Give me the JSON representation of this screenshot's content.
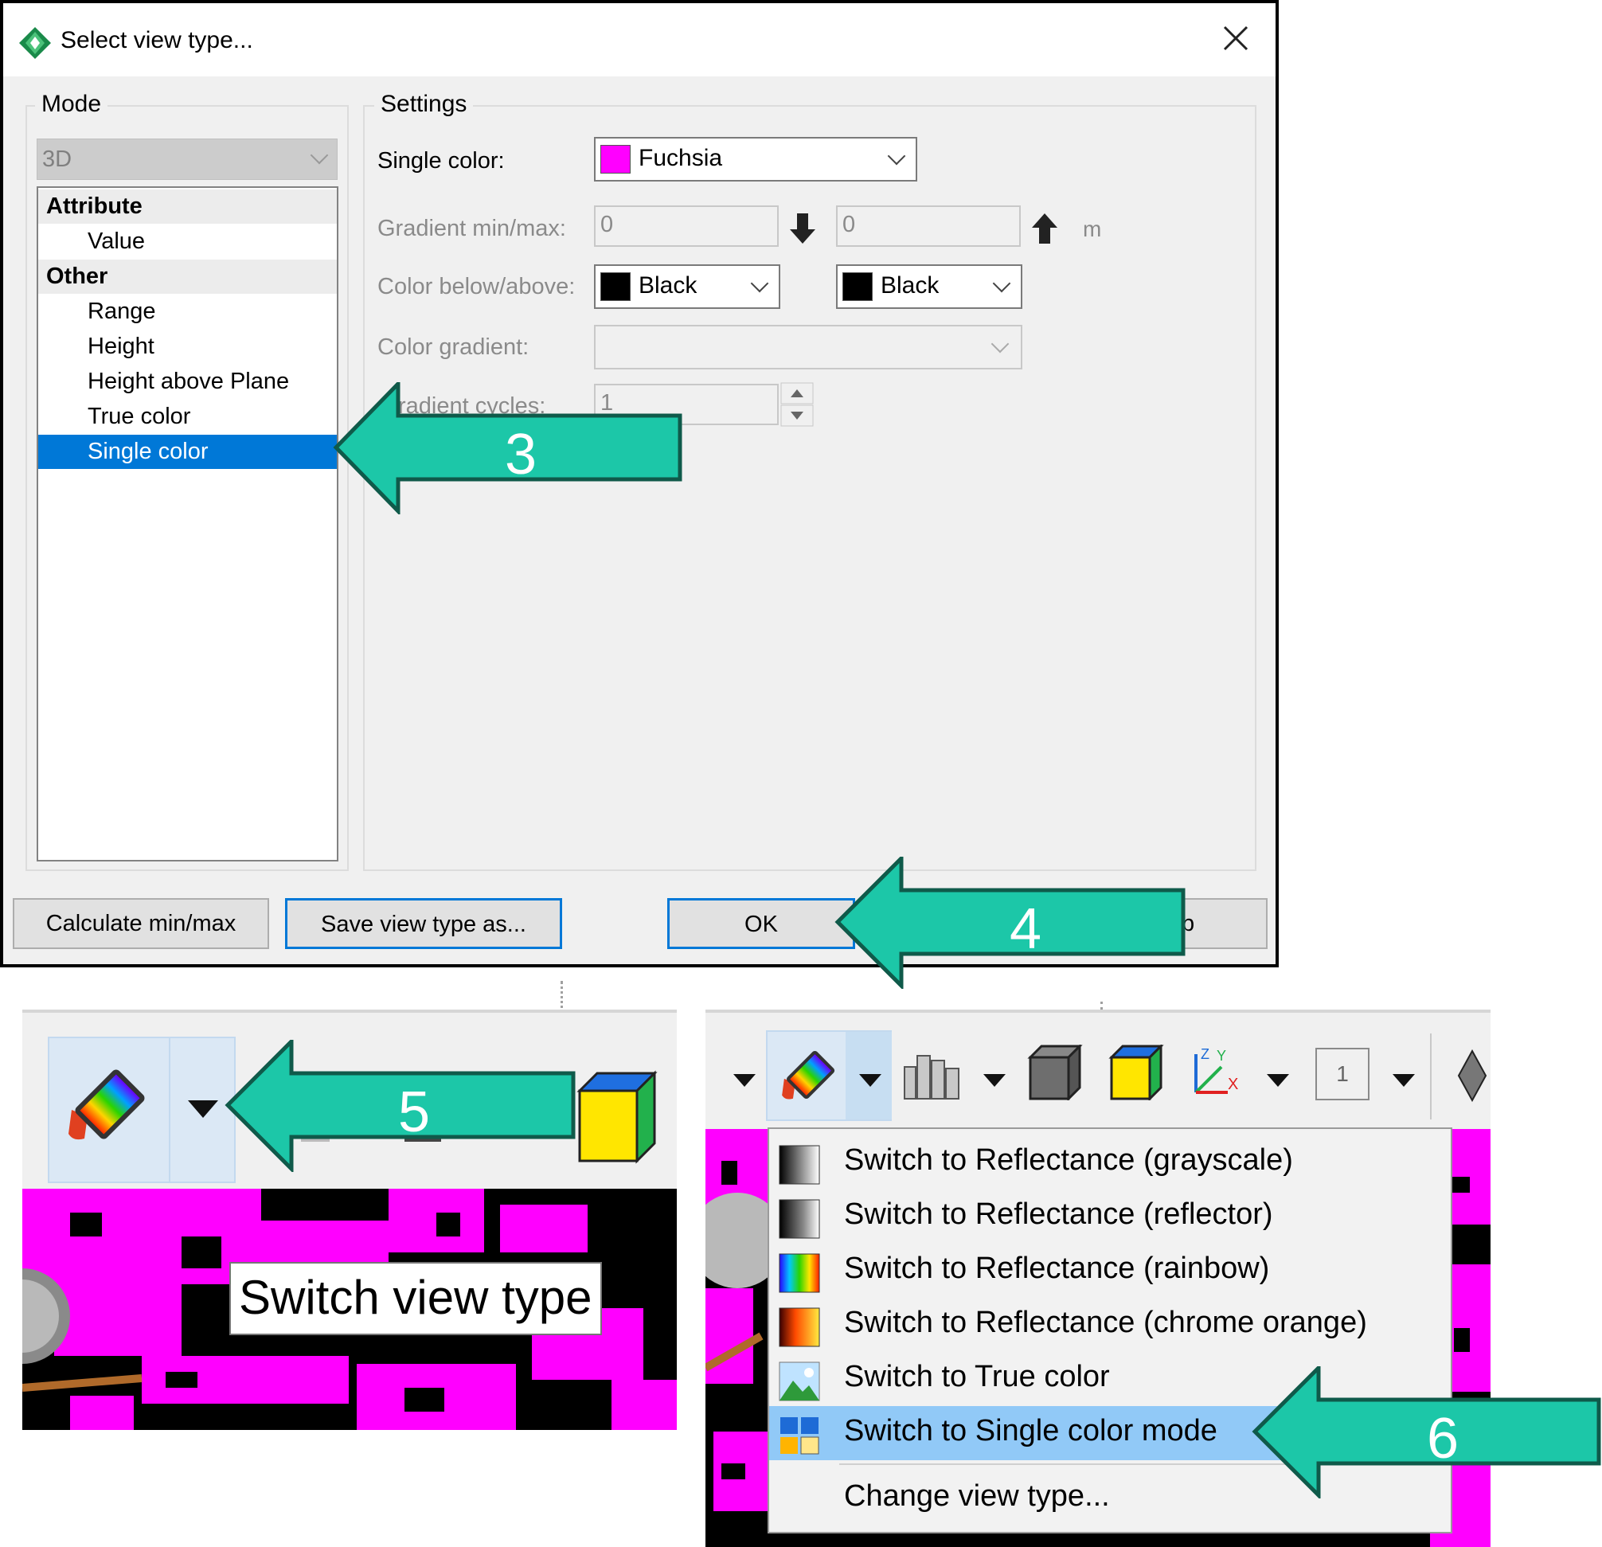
{
  "dialog": {
    "title": "Select view type...",
    "mode_group": "Mode",
    "settings_group": "Settings",
    "mode_select": "3D",
    "list": [
      {
        "label": "Attribute",
        "kind": "header"
      },
      {
        "label": "Value",
        "kind": "child"
      },
      {
        "label": "Other",
        "kind": "header"
      },
      {
        "label": "Range",
        "kind": "child"
      },
      {
        "label": "Height",
        "kind": "child"
      },
      {
        "label": "Height above Plane",
        "kind": "child"
      },
      {
        "label": "True color",
        "kind": "child"
      },
      {
        "label": "Single color",
        "kind": "child",
        "selected": true
      }
    ],
    "settings": {
      "single_color_label": "Single color:",
      "single_color_value": "Fuchsia",
      "single_color_hex": "#ff00ff",
      "gradient_minmax_label": "Gradient min/max:",
      "gradient_min": "0",
      "gradient_max": "0",
      "unit": "m",
      "color_below_above_label": "Color below/above:",
      "color_below": "Black",
      "color_above": "Black",
      "color_gradient_label": "Color gradient:",
      "gradient_cycles_label": "radient cycles:",
      "gradient_cycles": "1"
    },
    "buttons": {
      "calculate": "Calculate min/max",
      "save": "Save view type as...",
      "ok": "OK",
      "hidden_partial": "p"
    }
  },
  "callouts": [
    "3",
    "4",
    "5",
    "6"
  ],
  "callout_color": "#1cc7a8",
  "tooltip": "Switch view type",
  "menu": {
    "items": [
      {
        "label": "Switch to Reflectance (grayscale)",
        "icon": "grayscale-gradient-icon"
      },
      {
        "label": "Switch to Reflectance (reflector)",
        "icon": "reflector-gradient-icon"
      },
      {
        "label": "Switch to Reflectance (rainbow)",
        "icon": "rainbow-gradient-icon"
      },
      {
        "label": "Switch to Reflectance (chrome orange)",
        "icon": "chrome-orange-gradient-icon"
      },
      {
        "label": "Switch to True color",
        "icon": "landscape-icon"
      },
      {
        "label": "Switch to Single color mode",
        "icon": "single-color-grid-icon",
        "highlighted": true
      },
      {
        "label": "Change view type...",
        "icon": ""
      }
    ]
  },
  "toolbar": {
    "page_number": "1"
  },
  "colors": {
    "selection": "#0078d7",
    "menu_highlight": "#91c9f7",
    "point_cloud": "#ff00ff"
  }
}
